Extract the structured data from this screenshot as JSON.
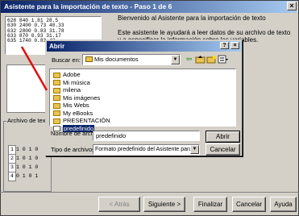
{
  "wizard": {
    "title": "Asistente para la importación de texto - Paso 1 de 6",
    "close_glyph": "×",
    "preview_lines": [
      "628 840 1.81 28.5",
      "630 2400 0.73 40.33",
      "632 2800 0.83 31.78",
      "633 870 0.93 31.17",
      "635 1740 0.83 43"
    ],
    "intro_line1": "Bienvenido al Asistente para la importación de texto",
    "intro_line2": "Este asistente le ayudará a leer datos de su archivo de texto y a especificar la información sobre las variables.",
    "file_origin_label": "Archivo de texto",
    "binary_rows": [
      {
        "n": "1",
        "bits": "1 0 1 0"
      },
      {
        "n": "2",
        "bits": "1 0 1 0"
      },
      {
        "n": "3",
        "bits": "1 0 1 0"
      },
      {
        "n": "4",
        "bits": "0 1 0 1"
      }
    ],
    "buttons": {
      "back": "< Atrás",
      "next": "Siguiente >",
      "finish": "Finalizar",
      "cancel": "Cancelar",
      "help": "Ayuda"
    }
  },
  "open_dialog": {
    "title": "Abrir",
    "help_glyph": "?",
    "close_glyph": "×",
    "lookin_label": "Buscar en:",
    "lookin_value": "Mis documentos",
    "files": [
      {
        "name": "Adobe",
        "type": "folder"
      },
      {
        "name": "Mi música",
        "type": "folder"
      },
      {
        "name": "milena",
        "type": "folder"
      },
      {
        "name": "Mis imágenes",
        "type": "folder"
      },
      {
        "name": "Mis Webs",
        "type": "folder"
      },
      {
        "name": "My eBooks",
        "type": "folder"
      },
      {
        "name": "PRESENTACIÓN",
        "type": "folder"
      },
      {
        "name": "predefinido",
        "type": "file",
        "selected": true
      }
    ],
    "filename_label": "Nombre de archivo:",
    "filename_value": "predefinido",
    "filetype_label": "Tipo de archivos:",
    "filetype_value": "Formato predefinido del Asistente para la",
    "open_button": "Abrir",
    "cancel_button": "Cancelar"
  },
  "colors": {
    "titlebar": "#0a246a",
    "selection": "#0a246a",
    "face": "#d4d0c8",
    "annotation": "#e01010"
  }
}
